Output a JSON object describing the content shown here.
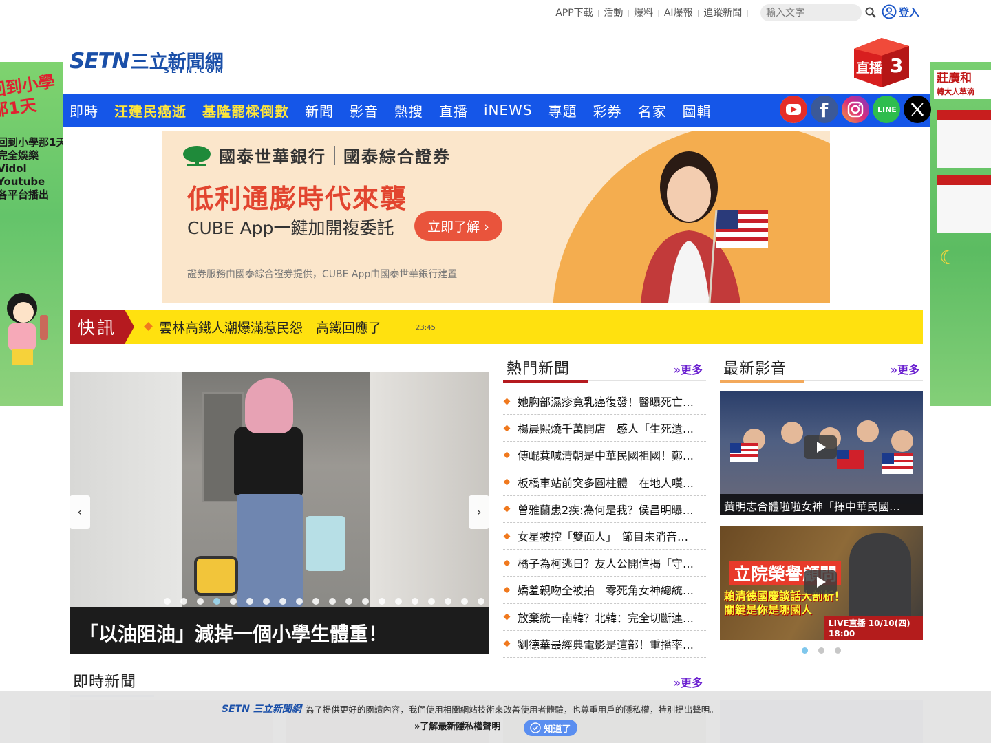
{
  "top_links": [
    "APP下載",
    "活動",
    "爆料",
    "AI爆報",
    "追蹤新聞"
  ],
  "search": {
    "placeholder": "輸入文字"
  },
  "login_label": "登入",
  "side_ad_left": {
    "line1": "回到小學",
    "line2": "那1天",
    "body": "回到小學那1天\n完全娛樂\nVidol\nYoutube\n各平台播出"
  },
  "side_ad_right": {
    "brand": "莊廣和",
    "brand_sub": "轉大人萃滴"
  },
  "logo": {
    "mark": "SETN",
    "name": "三立新聞網",
    "domain": "SETN.COM"
  },
  "live_badge": {
    "label": "直播",
    "number": "3"
  },
  "nav": {
    "items": [
      {
        "label": "即時",
        "highlight": false
      },
      {
        "label": "汪建民癌逝",
        "highlight": true
      },
      {
        "label": "基隆罷樑倒數",
        "highlight": true
      },
      {
        "label": "新聞",
        "highlight": false
      },
      {
        "label": "影音",
        "highlight": false
      },
      {
        "label": "熱搜",
        "highlight": false
      },
      {
        "label": "直播",
        "highlight": false
      },
      {
        "label": "iNEWS",
        "highlight": false
      },
      {
        "label": "專題",
        "highlight": false
      },
      {
        "label": "彩券",
        "highlight": false
      },
      {
        "label": "名家",
        "highlight": false
      },
      {
        "label": "圖輯",
        "highlight": false
      }
    ],
    "social_labels": {
      "line": "LINE"
    }
  },
  "banner_ad": {
    "bank": "國泰世華銀行",
    "securities": "國泰綜合證券",
    "headline": "低利通膨時代來襲",
    "subline": "CUBE App一鍵加開複委託",
    "cta": "立即了解 ›",
    "fine_print": "證券服務由國泰綜合證券提供，CUBE App由國泰世華銀行建置"
  },
  "breaking": {
    "label": "快訊",
    "text": "雲林高鐵人潮爆滿惹民怨　高鐵回應了",
    "time": "23:45"
  },
  "carousel": {
    "caption": "「以油阻油」減掉一個小學生體重！",
    "prev": "‹",
    "next": "›",
    "slide_count": 20,
    "active_slide": 4
  },
  "hot_news": {
    "title": "熱門新聞",
    "more": "»更多",
    "items": [
      "她胸部濕疹竟乳癌復發！醫曝死亡…",
      "楊晨熙燒千萬開店　感人「生死遺…",
      "傅崐萁喊清朝是中華民國祖國！鄭…",
      "板橋車站前突多圓柱體　在地人嘆…",
      "曾雅蘭患2疾:為何是我？侯昌明曝…",
      "女星被控「雙面人」　節目未消音…",
      "橘子為柯逃日？友人公開信揭「守…",
      "嬌羞親吻全被拍　零死角女神總統…",
      "放棄統一南韓？北韓：完全切斷連…",
      "劉德華最經典電影是這部！重播率…"
    ]
  },
  "latest_video": {
    "title": "最新影音",
    "more": "»更多",
    "video1_caption": "黃明志合體啦啦女神「揮中華民國…",
    "video2_title": "立院榮譽顧問",
    "video2_sub": "賴清德國慶談話大剖析！\n關鍵是你是哪國人",
    "video2_badge": "LIVE直播",
    "video2_date": "10/10(四) 18:00",
    "pages": 3,
    "active_page": 1
  },
  "instant_news": {
    "title": "即時新聞",
    "more": "»更多"
  },
  "cookie": {
    "logo_mark": "SETN",
    "logo_name": "三立新聞網",
    "message": "為了提供更好的閱讀內容，我們使用相關網站技術來改善使用者體驗，也尊重用戶的隱私權，特別提出聲明。",
    "privacy_link": "»了解最新隱私權聲明",
    "ok_button": "知道了"
  },
  "colors": {
    "nav_blue": "#1556e8",
    "nav_highlight": "#ffe63a",
    "breaking_bg": "#ffe10f",
    "breaking_label": "#b51a1f",
    "more_link": "#6a1fd0",
    "hot_underline": "#b51a1f",
    "video_underline": "#f3a95b"
  }
}
